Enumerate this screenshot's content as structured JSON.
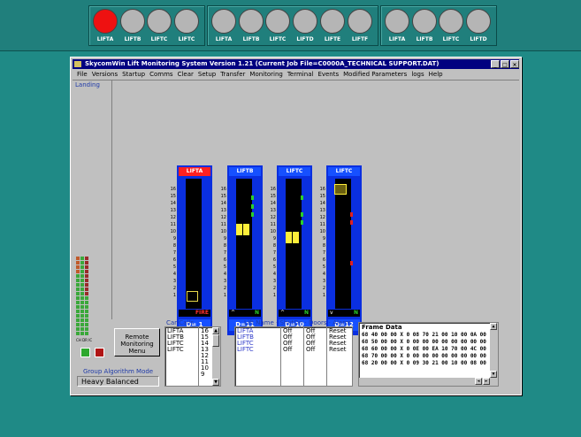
{
  "top_lamps": [
    {
      "label": "LIFTA",
      "on": true
    },
    {
      "label": "LIFTB",
      "on": false
    },
    {
      "label": "LIFTC",
      "on": false
    },
    {
      "label": "LIFTC",
      "on": false
    },
    {
      "label": "LIFTA",
      "on": false
    },
    {
      "label": "LIFTB",
      "on": false
    },
    {
      "label": "LIFTC",
      "on": false
    },
    {
      "label": "LIFTD",
      "on": false
    },
    {
      "label": "LIFTE",
      "on": false
    },
    {
      "label": "LIFTF",
      "on": false
    },
    {
      "label": "LIFTA",
      "on": false
    },
    {
      "label": "LIFTB",
      "on": false
    },
    {
      "label": "LIFTC",
      "on": false
    },
    {
      "label": "LIFTD",
      "on": false
    }
  ],
  "window": {
    "title": "SkycomWin Lift Monitoring System Version 1.21 (Current Job File=C0000A_TECHNICAL SUPPORT.DAT)",
    "menu": [
      "File",
      "Versions",
      "Startup",
      "Comms",
      "Clear",
      "Setup",
      "Transfer",
      "Monitoring",
      "Terminal",
      "Events",
      "Modified Parameters",
      "logs",
      "Help"
    ]
  },
  "left_panel": {
    "landing_label": "Landing",
    "bar_labels": "CH DR IC"
  },
  "shafts": [
    {
      "name": "LIFTA",
      "header_color": "#ff2020",
      "status_left": "",
      "status_right": "FIRE",
      "footer": "D= 1",
      "car_floor": 2,
      "car_style": "outline",
      "calls": []
    },
    {
      "name": "LIFTB",
      "header_color": "#1650ff",
      "status_left": "^",
      "status_right": "N",
      "footer": "D=11",
      "car_floor": 10,
      "car_style": "doors",
      "calls": [
        14,
        13,
        12
      ]
    },
    {
      "name": "LIFTC",
      "header_color": "#1650ff",
      "status_left": "^",
      "status_right": "N",
      "footer": "D=10",
      "car_floor": 9,
      "car_style": "doors",
      "calls": [
        14,
        12,
        11
      ]
    },
    {
      "name": "LIFTC",
      "header_color": "#1650ff",
      "status_left": "v",
      "status_right": "N",
      "footer": "D=12",
      "car_floor": 15,
      "car_style": "closed",
      "calls": [
        12,
        11,
        6
      ]
    }
  ],
  "floors": [
    "16",
    "15",
    "14",
    "13",
    "12",
    "11",
    "10",
    "9",
    "8",
    "7",
    "6",
    "5",
    "4",
    "3",
    "2",
    "1"
  ],
  "remote_menu": {
    "label": "Remote Monitoring Menu"
  },
  "group_algorithm": {
    "label": "Group Algorithm Mode",
    "value": "Heavy Balanced"
  },
  "car_calls": {
    "label": "Car Calls",
    "lifts": [
      "LIFTA",
      "LIFTB",
      "LIFTC",
      "LIFTC"
    ],
    "floors": [
      "16",
      "15",
      "14",
      "13",
      "12",
      "11",
      "10",
      "9"
    ]
  },
  "status_table": {
    "header": "Lift Name · ShutDn · Doors · Alarm",
    "rows": [
      {
        "name": "LIFTA",
        "shutdn": "Off",
        "doors": "Off",
        "alarm": "Reset"
      },
      {
        "name": "LIFTB",
        "shutdn": "Off",
        "doors": "Off",
        "alarm": "Reset"
      },
      {
        "name": "LIFTC",
        "shutdn": "Off",
        "doors": "Off",
        "alarm": "Reset"
      },
      {
        "name": "LIFTC",
        "shutdn": "Off",
        "doors": "Off",
        "alarm": "Reset"
      }
    ]
  },
  "frame_data": {
    "title": "Frame Data",
    "lines": [
      "68 40 00 00 X 0 08 70 21 00 10 00 0A 00",
      "68 50 00 00 X 0 00 00 00 00 00 00 00 00",
      "68 60 00 00 X 0 0E 00 EA 10 70 00 4C 00",
      "68 70 00 00 X 0 00 00 00 00 00 00 00 00",
      "68 20 00 00 X 0 09 30 21 00 10 00 08 00"
    ]
  },
  "colors": {
    "teal": "#1f8a86",
    "window_grey": "#c0c0c0",
    "shaft_blue": "#0a2fe0",
    "title_blue": "#000080"
  }
}
